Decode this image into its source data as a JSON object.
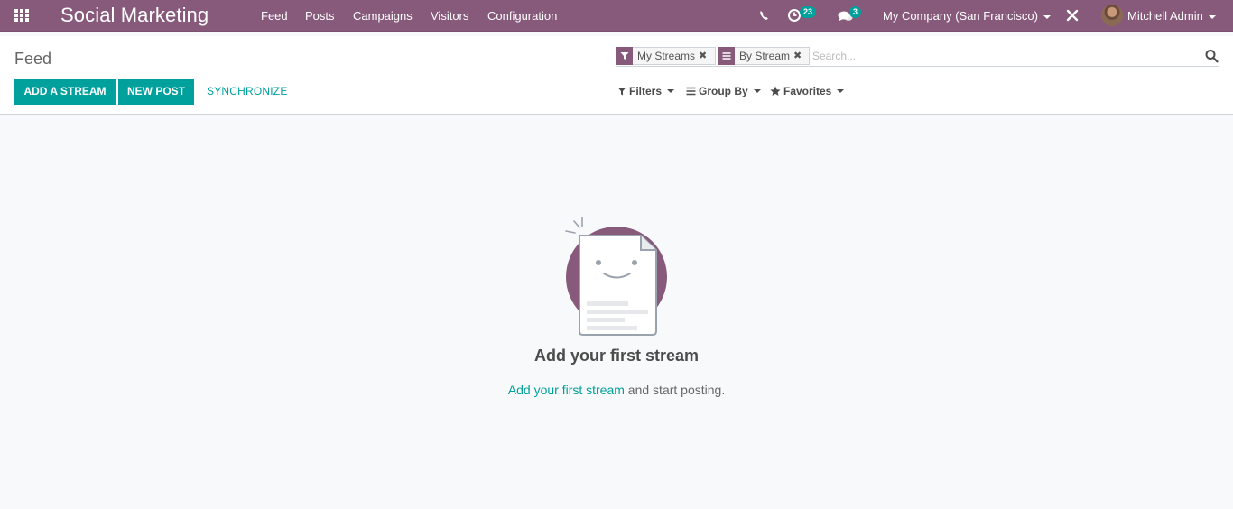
{
  "navbar": {
    "brand": "Social Marketing",
    "menu": [
      {
        "label": "Feed"
      },
      {
        "label": "Posts"
      },
      {
        "label": "Campaigns"
      },
      {
        "label": "Visitors"
      },
      {
        "label": "Configuration"
      }
    ],
    "activity_count": "23",
    "message_count": "3",
    "company": "My Company (San Francisco)",
    "user": "Mitchell Admin"
  },
  "control_panel": {
    "breadcrumb": "Feed",
    "buttons": {
      "add_stream": "ADD A STREAM",
      "new_post": "NEW POST",
      "synchronize": "SYNCHRONIZE"
    },
    "search": {
      "facets": [
        {
          "label": "My Streams",
          "icon": "filter-icon"
        },
        {
          "label": "By Stream",
          "icon": "group-icon"
        }
      ],
      "placeholder": "Search..."
    },
    "filters_label": "Filters",
    "group_by_label": "Group By",
    "favorites_label": "Favorites"
  },
  "helper": {
    "title": "Add your first stream",
    "link_text": "Add your first stream",
    "text_after": " and start posting."
  },
  "colors": {
    "brand": "#875a7b",
    "primary": "#00a09d"
  }
}
